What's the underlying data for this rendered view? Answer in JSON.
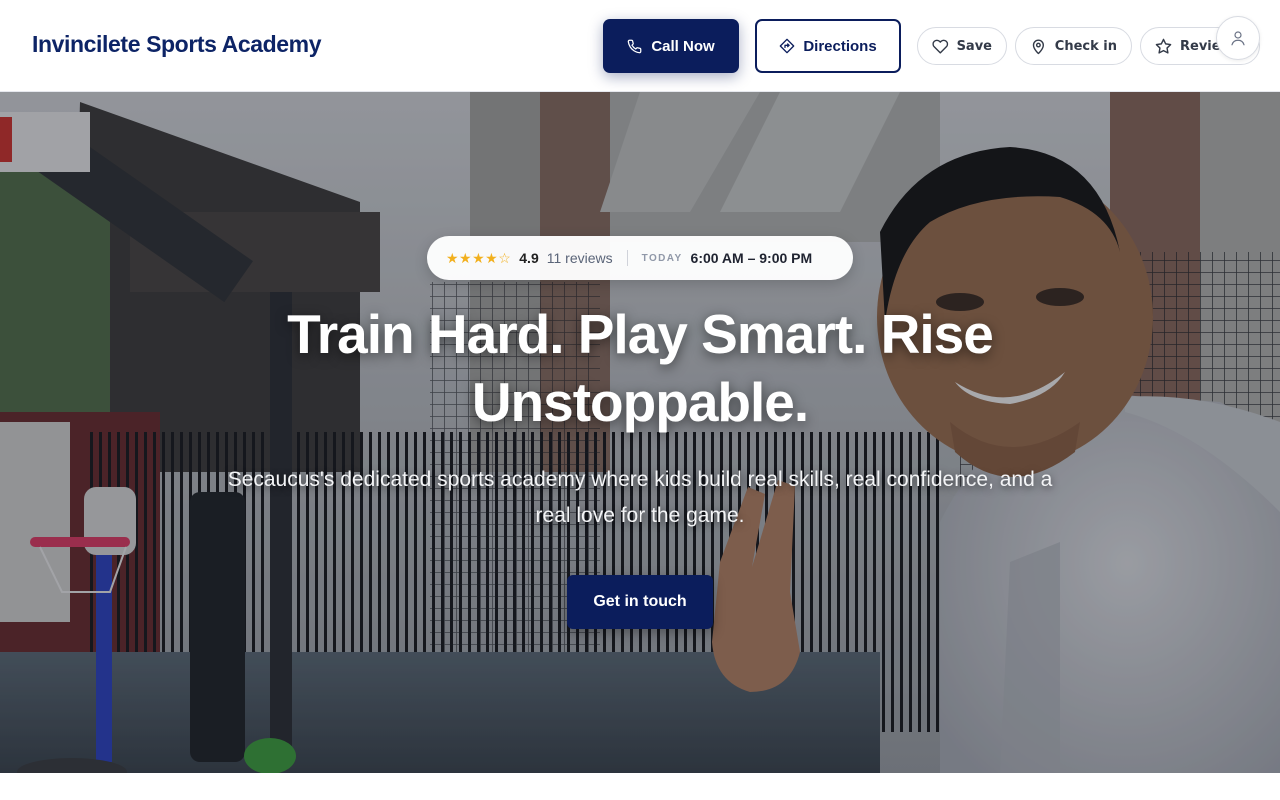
{
  "header": {
    "brand": "Invincilete Sports Academy",
    "call_label": "Call Now",
    "directions_label": "Directions",
    "save_label": "Save",
    "checkin_label": "Check in",
    "review_label": "Review"
  },
  "hero": {
    "stars": "★★★★☆",
    "rating": "4.9",
    "reviews": "11 reviews",
    "today_label": "TODAY",
    "hours": "6:00 AM – 9:00 PM",
    "headline": "Train Hard. Play Smart. Rise Unstoppable.",
    "subhead": "Secaucus's dedicated sports academy where kids build real skills, real confidence, and a real love for the game.",
    "cta_label": "Get in touch"
  },
  "colors": {
    "brand_navy": "#0b1d5c",
    "star_gold": "#f2b01e"
  },
  "icons": [
    "phone-icon",
    "directions-icon",
    "heart-icon",
    "location-pin-icon",
    "star-icon",
    "user-icon"
  ]
}
